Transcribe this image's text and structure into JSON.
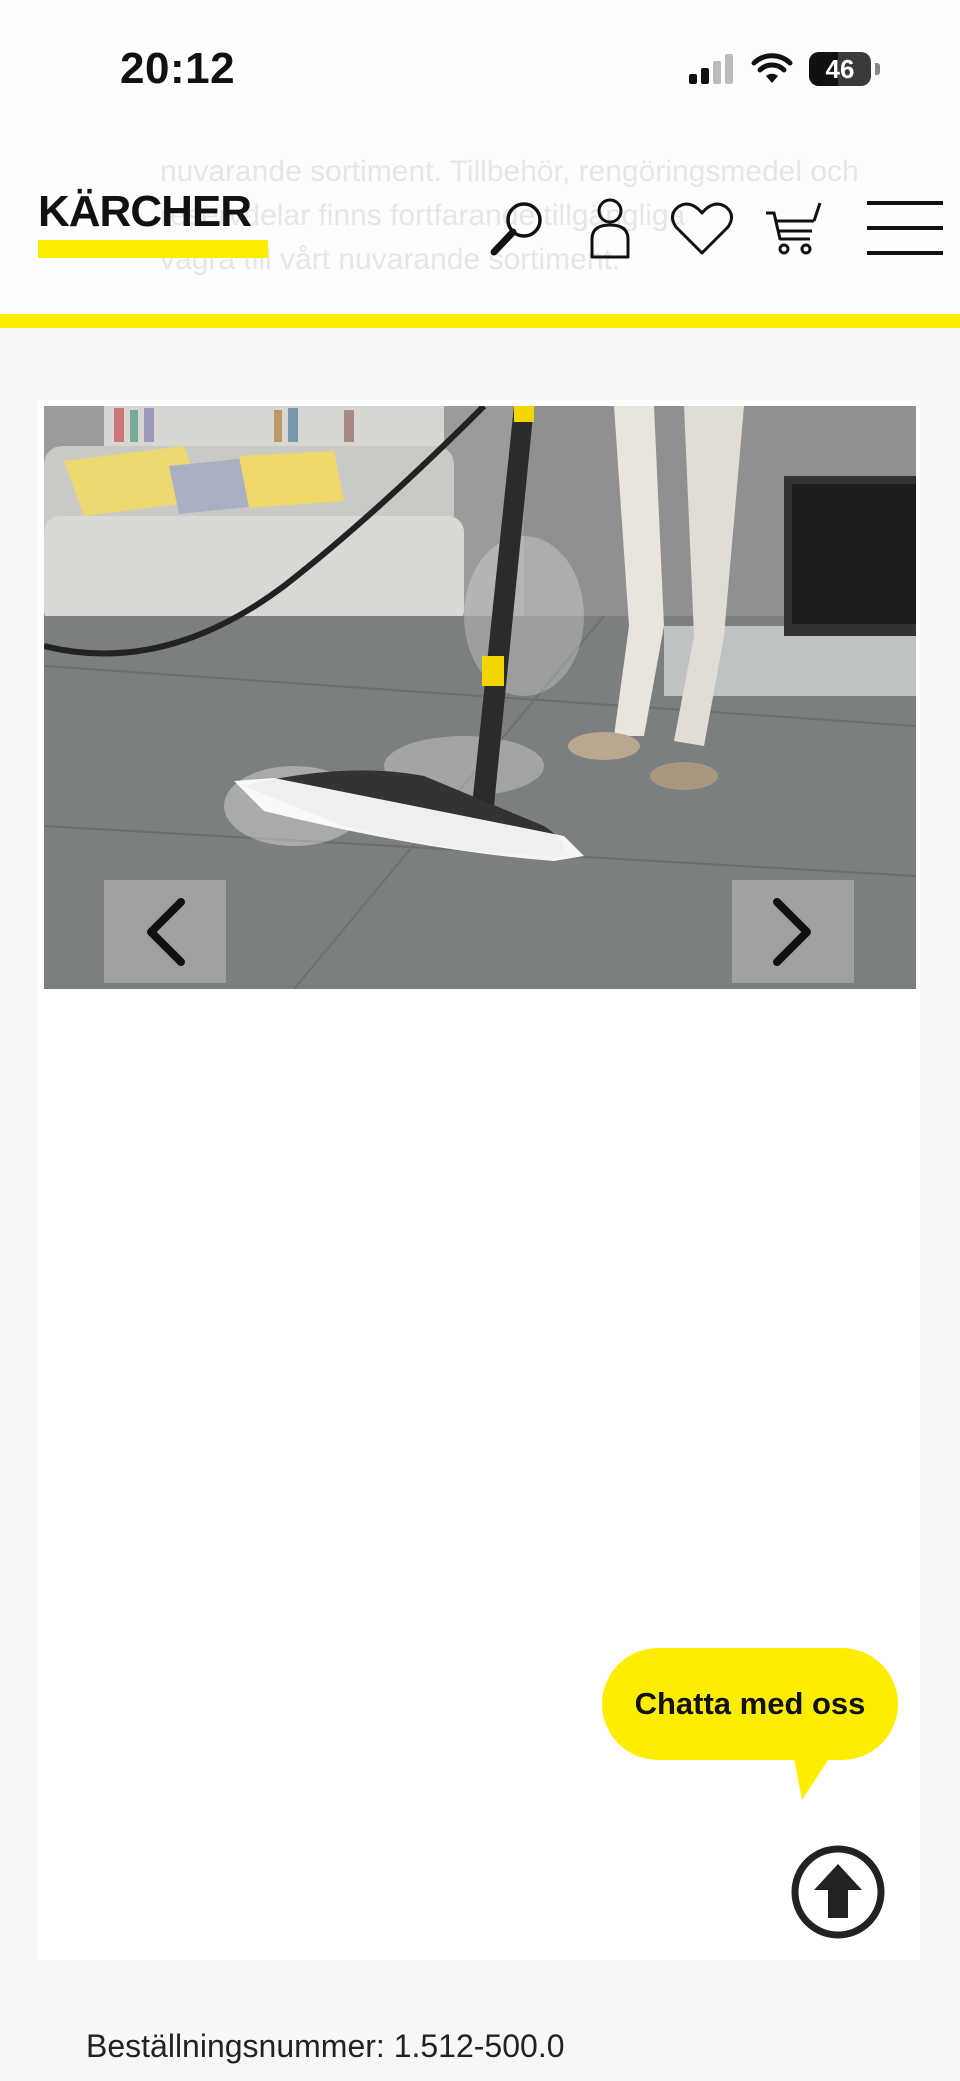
{
  "status_bar": {
    "time": "20:12",
    "battery": "46"
  },
  "header": {
    "logo_text": "KÄRCHER",
    "ghost_lines": [
      "nuvarande sortiment. Tillbehör, rengöringsmedel och",
      "reservdelar finns fortfarande tillgängliga",
      "vägra till vårt nuvarande sortiment."
    ],
    "icons": [
      "search-icon",
      "user-icon",
      "heart-icon",
      "cart-icon",
      "menu-icon"
    ]
  },
  "gallery": {
    "image_subject": "steam-mop-on-tile-floor",
    "prev_icon": "chevron-left-icon",
    "next_icon": "chevron-right-icon"
  },
  "chat": {
    "label": "Chatta med oss"
  },
  "scroll_top": {
    "icon": "arrow-up-circle-icon"
  },
  "product": {
    "order_number": "Beställningsnummer: 1.512-500.0"
  },
  "colors": {
    "brand_yellow": "#ffed00",
    "text": "#111111",
    "background": "#f7f7f7"
  }
}
